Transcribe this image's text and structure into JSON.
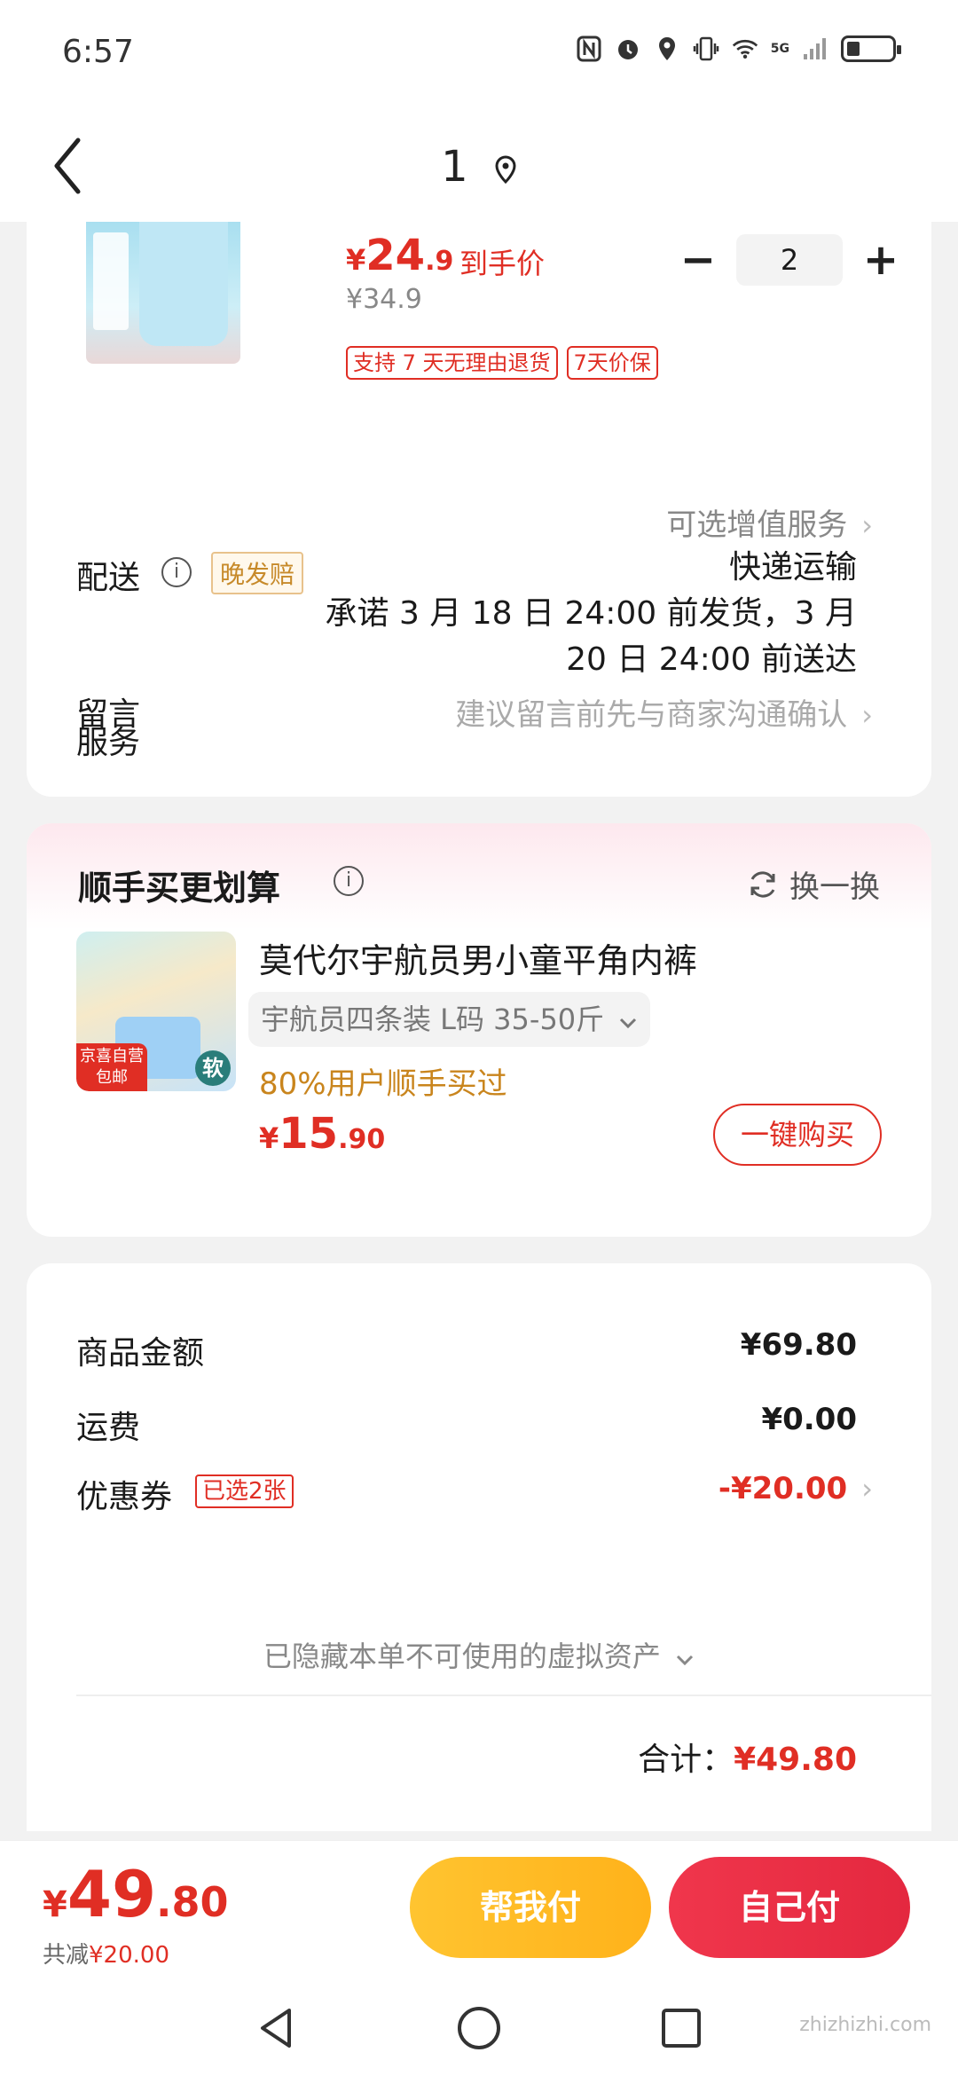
{
  "status_bar": {
    "time": "6:57",
    "network": "5G"
  },
  "header": {
    "title": "1"
  },
  "product": {
    "price_yen": "¥",
    "price_int": "24",
    "price_dec": ".9",
    "price_label": "到手价",
    "orig_price": "¥34.9",
    "badges": [
      "支持 7 天无理由退货",
      "7天价保"
    ],
    "qty_minus": "−",
    "qty": "2",
    "qty_plus": "+"
  },
  "service": {
    "label": "服务",
    "value": "可选增值服务"
  },
  "delivery": {
    "label": "配送",
    "info": "i",
    "badge": "晚发赔",
    "method": "快递运输",
    "promise_line1": "承诺 3 月 18 日 24:00 前发货，3 月",
    "promise_line2": "20 日 24:00 前送达"
  },
  "message": {
    "label": "留言",
    "placeholder": "建议留言前先与商家沟通确认"
  },
  "chevron": "›",
  "upsell": {
    "title": "顺手买更划算",
    "info": "i",
    "swap": "换一换",
    "img_tag": "京喜自营\n包邮",
    "img_soft": "软",
    "name": "莫代尔宇航员男小童平角内裤",
    "spec": "宇航员四条装  L码 35-50斤",
    "rate": "80%用户顺手买过",
    "price_yen": "¥",
    "price_int": "15",
    "price_dec": ".90",
    "buy": "一键购买"
  },
  "summary": {
    "goods_label": "商品金额",
    "goods_value": "¥69.80",
    "shipping_label": "运费",
    "shipping_value": "¥0.00",
    "coupon_label": "优惠券",
    "coupon_badge": "已选2张",
    "coupon_value": "-¥20.00",
    "hidden_note": "已隐藏本单不可使用的虚拟资产",
    "total_label": "合计：",
    "total_value": "¥49.80"
  },
  "bottom": {
    "price_yen": "¥",
    "price_int": "49",
    "price_dec": ".80",
    "saved_label": "共减",
    "saved_value": "¥20.00",
    "help_pay": "帮我付",
    "self_pay": "自己付"
  },
  "watermark": "zhizhizhi.com",
  "colors": {
    "accent": "#e02e24",
    "yellow": "#ffc430",
    "red_button": "#e4283f"
  }
}
